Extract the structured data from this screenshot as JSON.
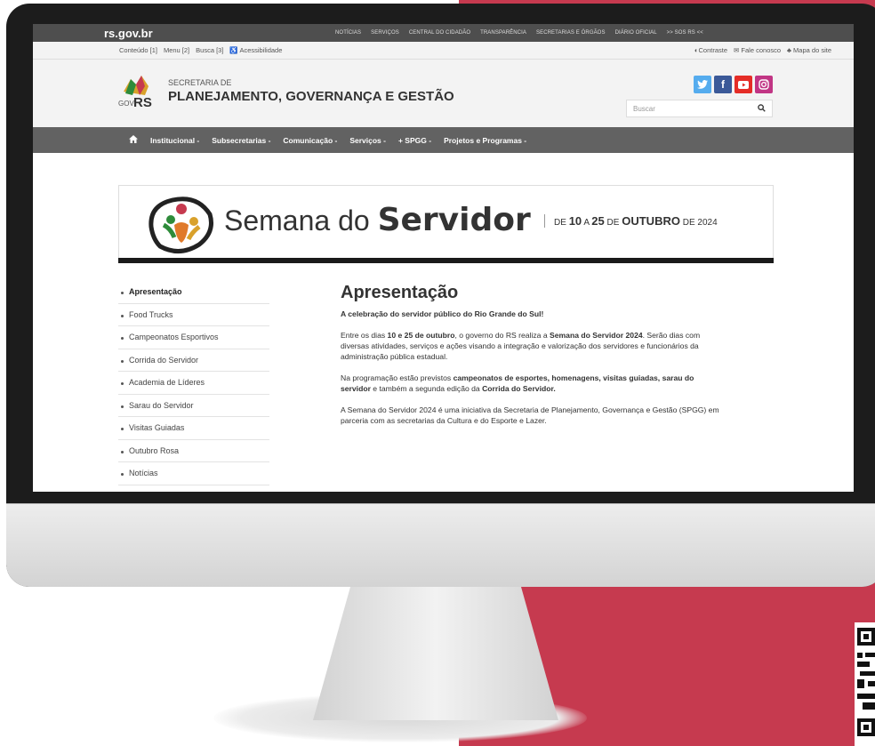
{
  "site": {
    "brand": "rs.gov.br",
    "top_nav": [
      "NOTÍCIAS",
      "SERVIÇOS",
      "CENTRAL DO CIDADÃO",
      "TRANSPARÊNCIA",
      "SECRETARIAS E ÓRGÃOS",
      "DIÁRIO OFICIAL",
      ">> SOS RS <<"
    ],
    "accessibility_links": [
      "Conteúdo [1]",
      "Menu [2]",
      "Busca [3]",
      "Acessibilidade"
    ],
    "utility_links": [
      "Contraste",
      "Fale conosco",
      "Mapa do site"
    ],
    "org_line1": "SECRETARIA DE",
    "org_line2": "PLANEJAMENTO, GOVERNANÇA E GESTÃO",
    "logo_gov": "GOV",
    "logo_rs": "RS",
    "search_placeholder": "Buscar",
    "main_nav": [
      "Institucional -",
      "Subsecretarias -",
      "Comunicação -",
      "Serviços -",
      "+ SPGG -",
      "Projetos e Programas -"
    ]
  },
  "banner": {
    "title_light": "Semana do",
    "title_bold": "Servidor",
    "date_de": "DE",
    "date_start": "10",
    "date_a": "A",
    "date_end": "25",
    "date_de2": "DE",
    "date_month": "OUTUBRO",
    "date_de3": "DE",
    "date_year": "2024"
  },
  "sidebar": {
    "items": [
      "Apresentação",
      "Food Trucks",
      "Campeonatos Esportivos",
      "Corrida do Servidor",
      "Academia de Líderes",
      "Sarau do Servidor",
      "Visitas Guiadas",
      "Outubro Rosa",
      "Notícias"
    ]
  },
  "content": {
    "title": "Apresentação",
    "lead": "A celebração do servidor público do Rio Grande do Sul!",
    "p1_a": "Entre os dias ",
    "p1_b": "10 e 25 de outubro",
    "p1_c": ", o governo do RS realiza a ",
    "p1_d": "Semana do Servidor 2024",
    "p1_e": ". Serão dias com diversas atividades, serviços e ações visando a integração e valorização dos servidores e funcionários da administração pública estadual.",
    "p2_a": "Na programação estão previstos ",
    "p2_b": "campeonatos de esportes, homenagens, visitas guiadas, sarau do servidor",
    "p2_c": " e também a segunda edição da ",
    "p2_d": "Corrida do Servidor.",
    "p3": "A Semana do Servidor 2024 é uma iniciativa da Secretaria de Planejamento, Governança e Gestão (SPGG) em parceria com as secretarias da Cultura e do Esporte e Lazer."
  },
  "colors": {
    "accent_red": "#c63a4f",
    "twitter": "#55acee",
    "facebook": "#3b5998",
    "youtube": "#e52d27",
    "instagram": "#c13584"
  }
}
